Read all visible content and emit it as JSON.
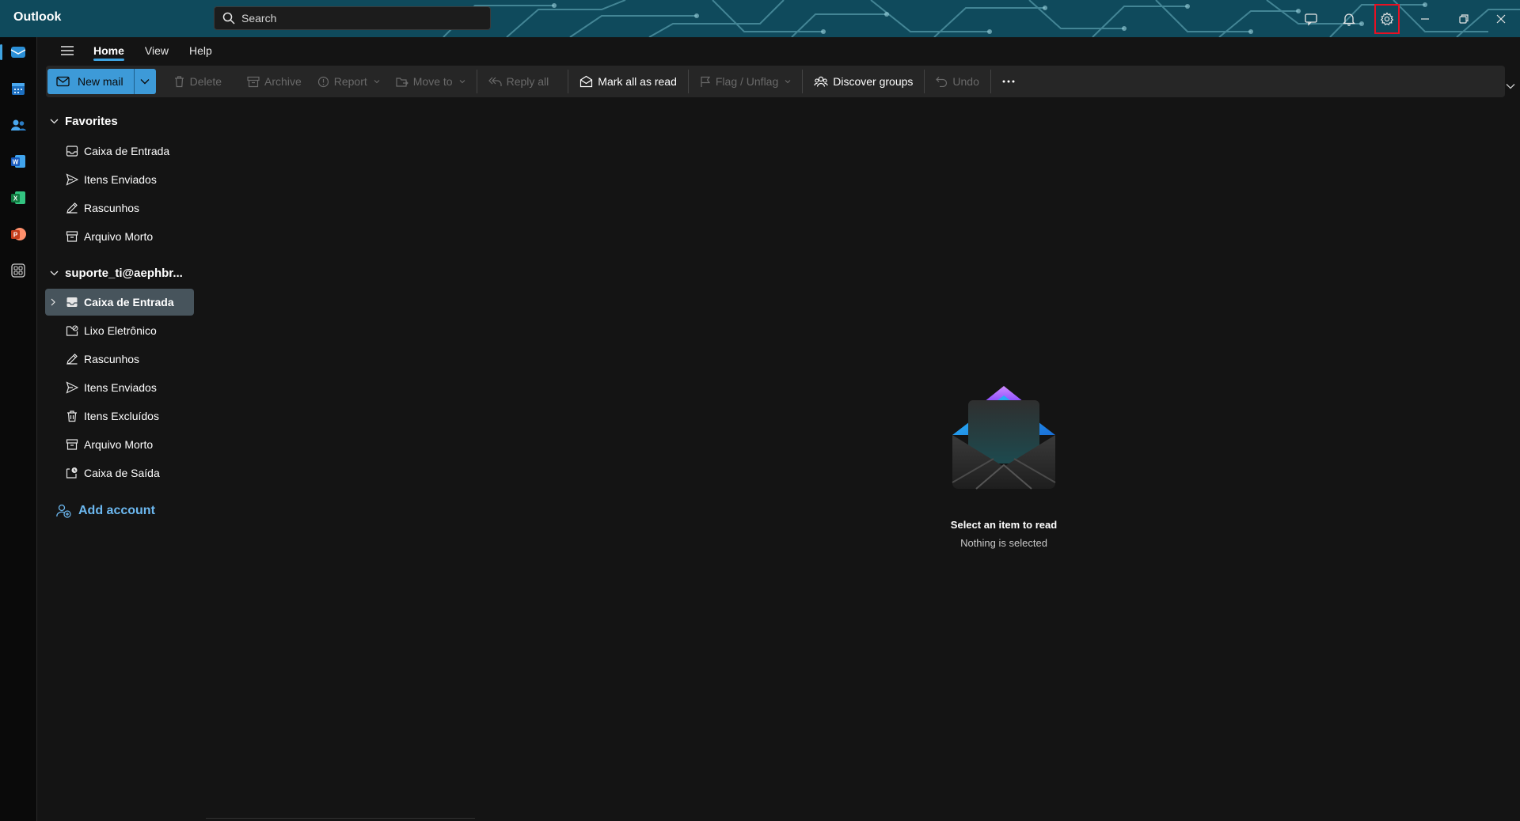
{
  "app": {
    "name": "Outlook"
  },
  "search": {
    "placeholder": "Search"
  },
  "ribbon": {
    "tabs": [
      {
        "label": "Home",
        "active": true
      },
      {
        "label": "View",
        "active": false
      },
      {
        "label": "Help",
        "active": false
      }
    ]
  },
  "toolbar": {
    "new_mail": "New mail",
    "delete": "Delete",
    "archive": "Archive",
    "report": "Report",
    "move_to": "Move to",
    "reply_all": "Reply all",
    "mark_all_read": "Mark all as read",
    "flag": "Flag / Unflag",
    "discover_groups": "Discover groups",
    "undo": "Undo"
  },
  "favorites": {
    "header": "Favorites",
    "items": [
      {
        "label": "Caixa de Entrada",
        "icon": "inbox-icon"
      },
      {
        "label": "Itens Enviados",
        "icon": "send-icon"
      },
      {
        "label": "Rascunhos",
        "icon": "draft-icon"
      },
      {
        "label": "Arquivo Morto",
        "icon": "archive-icon"
      }
    ]
  },
  "account": {
    "header": "suporte_ti@aephbr...",
    "items": [
      {
        "label": "Caixa de Entrada",
        "icon": "inbox-icon",
        "selected": true
      },
      {
        "label": "Lixo Eletrônico",
        "icon": "junk-icon"
      },
      {
        "label": "Rascunhos",
        "icon": "draft-icon"
      },
      {
        "label": "Itens Enviados",
        "icon": "send-icon"
      },
      {
        "label": "Itens Excluídos",
        "icon": "trash-icon"
      },
      {
        "label": "Arquivo Morto",
        "icon": "archive-icon"
      },
      {
        "label": "Caixa de Saída",
        "icon": "outbox-icon"
      }
    ]
  },
  "add_account": "Add account",
  "reading_pane": {
    "title": "Select an item to read",
    "subtitle": "Nothing is selected"
  },
  "colors": {
    "accent": "#3d9ad8",
    "titlebar": "#0f4a5c",
    "background": "#141414",
    "selected_folder": "#47545c",
    "highlight_box": "#e81123"
  }
}
